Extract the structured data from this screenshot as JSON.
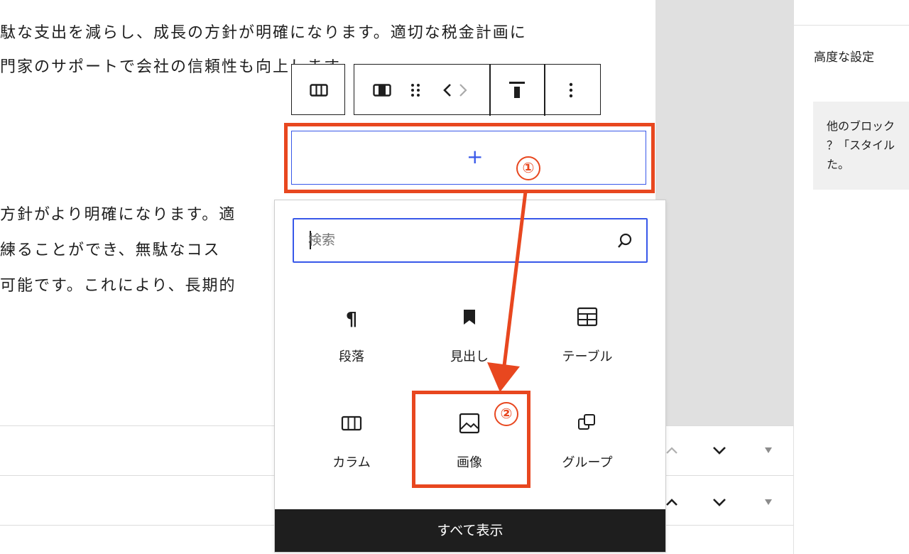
{
  "content": {
    "line1": "駄な支出を減らし、成長の方針が明確になります。適切な税金計画に",
    "line2": "門家のサポートで会社の信頼性も向上します。",
    "line3": "方針がより明確になります。適",
    "line4": "練ることができ、無駄なコス",
    "line5": "可能です。これにより、長期的"
  },
  "sidebar": {
    "advanced_label": "高度な設定",
    "note_lines": [
      "他のブロック",
      "？「スタイル",
      "た。"
    ]
  },
  "toolbar": {
    "columns_icon": "columns-icon",
    "column_icon": "column-icon",
    "drag_icon": "drag-handle-icon",
    "prev_icon": "chevron-left-icon",
    "next_icon": "chevron-right-icon",
    "align_icon": "align-top-icon",
    "more_icon": "more-vertical-icon"
  },
  "appender": {
    "plus": "+"
  },
  "annotations": {
    "step1": "①",
    "step2": "②",
    "accent": "#e8471f"
  },
  "inserter": {
    "search_placeholder": "検索",
    "blocks": [
      {
        "label": "段落",
        "icon": "paragraph-icon"
      },
      {
        "label": "見出し",
        "icon": "heading-bookmark-icon"
      },
      {
        "label": "テーブル",
        "icon": "table-icon"
      },
      {
        "label": "カラム",
        "icon": "columns-icon"
      },
      {
        "label": "画像",
        "icon": "image-icon"
      },
      {
        "label": "グループ",
        "icon": "group-icon"
      }
    ],
    "show_all": "すべて表示"
  },
  "colors": {
    "primary": "#3858e9",
    "dark": "#1e1e1e",
    "highlight": "#e8471f"
  }
}
